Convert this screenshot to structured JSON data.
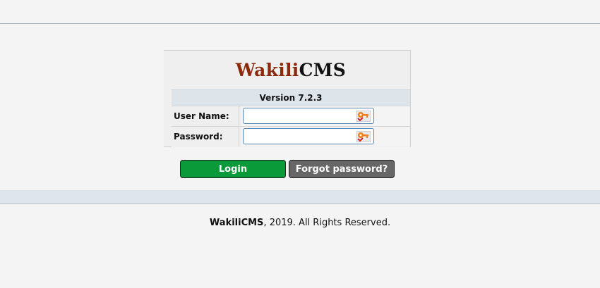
{
  "app": {
    "logo_part1": "Wakili",
    "logo_part2": "CMS",
    "version": "Version 7.2.3"
  },
  "form": {
    "username_label": "User Name:",
    "username_value": "",
    "password_label": "Password:",
    "password_value": ""
  },
  "buttons": {
    "login": "Login",
    "forgot": "Forgot password?"
  },
  "footer": {
    "brand": "WakiliCMS",
    "text": ", 2019. All Rights Reserved."
  },
  "colors": {
    "accent_bar": "#2b5b86",
    "logo_red": "#8b2a0c",
    "login_green": "#0a9a3a",
    "forgot_gray": "#666666"
  },
  "icons": {
    "field_icon": "key-icon"
  }
}
